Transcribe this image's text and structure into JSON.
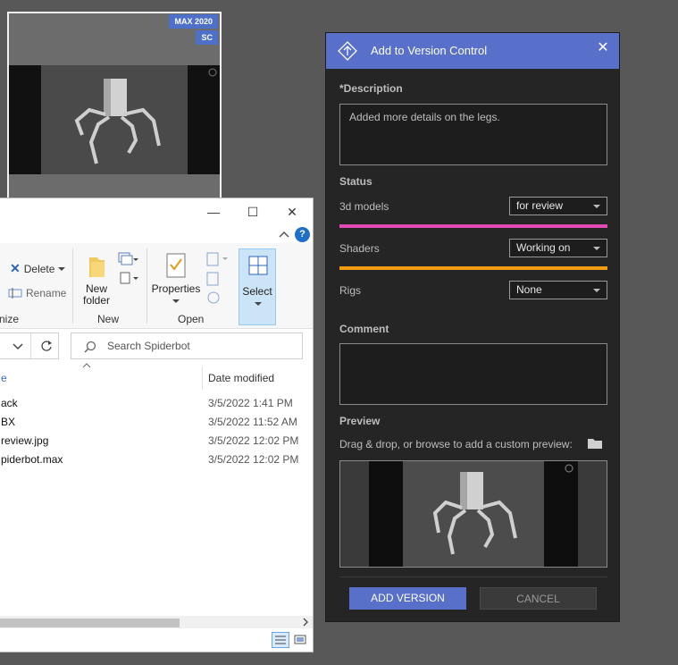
{
  "thumbnail": {
    "badges": [
      "MAX 2020",
      "SC"
    ]
  },
  "explorer": {
    "window_controls": [
      "—",
      "☐",
      "✕"
    ],
    "ribbon": {
      "delete_label": "Delete",
      "rename_label": "Rename",
      "new_folder_label": "New folder",
      "properties_label": "Properties",
      "select_label": "Select",
      "groups": [
        "nize",
        "New",
        "Open"
      ]
    },
    "search_placeholder": "Search Spiderbot",
    "columns": {
      "name": "e",
      "date": "Date modified"
    },
    "files": [
      {
        "name": "ack",
        "date": "3/5/2022 1:41 PM"
      },
      {
        "name": "BX",
        "date": "3/5/2022 11:52 AM"
      },
      {
        "name": "review.jpg",
        "date": "3/5/2022 12:02 PM"
      },
      {
        "name": "piderbot.max",
        "date": "3/5/2022 12:02 PM"
      }
    ]
  },
  "dialog": {
    "title": "Add to Version Control",
    "close_label": "✕",
    "description_label": "*Description",
    "description_value": "Added more details on the legs.",
    "status_label": "Status",
    "status_rows": [
      {
        "label": "3d models",
        "value": "for review",
        "bar_color": "#e24ab5"
      },
      {
        "label": "Shaders",
        "value": "Working on",
        "bar_color": "#f29b12"
      },
      {
        "label": "Rigs",
        "value": "None",
        "bar_color": ""
      }
    ],
    "comment_label": "Comment",
    "comment_value": "",
    "preview_label": "Preview",
    "preview_hint": "Drag & drop, or browse to add a custom preview:",
    "add_button": "ADD VERSION",
    "cancel_button": "CANCEL"
  },
  "colors": {
    "accent": "#5870c9",
    "background": "#585858",
    "panel": "#252525"
  }
}
